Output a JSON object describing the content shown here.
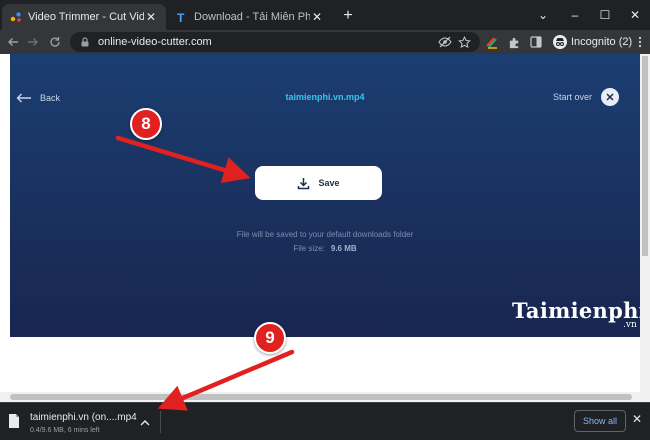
{
  "browser": {
    "tabs": [
      {
        "title": "Video Trimmer - Cut Video Online",
        "close": "✕",
        "active": true
      },
      {
        "title": "Download - Tải Miễn Phí VN - Ph",
        "close": "✕",
        "active": false
      }
    ],
    "new_tab": "+",
    "window_controls": {
      "chevron": "⌄",
      "minimize": "–",
      "maximize": "☐",
      "close": "✕"
    },
    "url": "online-video-cutter.com",
    "incognito_label": "Incognito (2)"
  },
  "page": {
    "back_label": "Back",
    "filename": "taimienphi.vn.mp4",
    "start_over_label": "Start over",
    "save_label": "Save",
    "save_note": "File will be saved to your default downloads folder",
    "file_size_label": "File size:",
    "file_size_value": "9.6 MB",
    "watermark": "Taimienphi",
    "watermark_sub": ".vn"
  },
  "downloads": {
    "item_name": "taimienphi.vn (on....mp4",
    "item_status": "0.4/9.6 MB, 6 mins left",
    "show_all_label": "Show all",
    "close": "✕"
  },
  "annotations": {
    "badge_save": "8",
    "badge_download": "9",
    "accent_color": "#e1211f"
  },
  "colors": {
    "hero_top": "#1b3e72",
    "hero_bottom": "#182650",
    "filename": "#35c6ee",
    "chrome_dark": "#202124",
    "chrome_toolbar": "#35363a"
  }
}
